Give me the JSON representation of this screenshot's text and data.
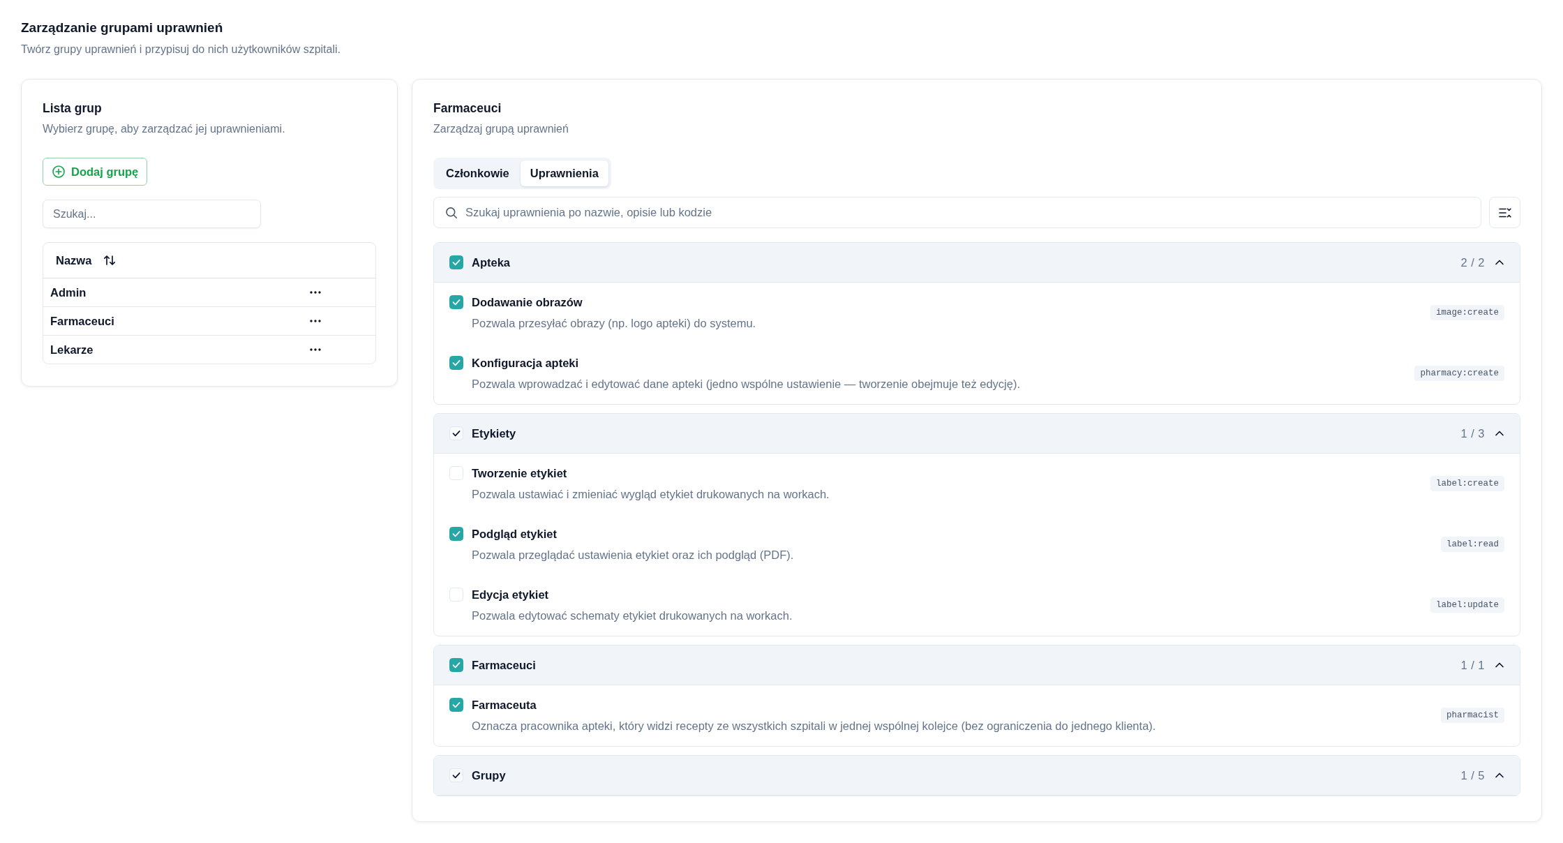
{
  "page": {
    "title": "Zarządzanie grupami uprawnień",
    "subtitle": "Twórz grupy uprawnień i przypisuj do nich użytkowników szpitali."
  },
  "group_list": {
    "title": "Lista grup",
    "subtitle": "Wybierz grupę, aby zarządzać jej uprawnieniami.",
    "add_button": "Dodaj grupę",
    "search": {
      "placeholder": "Szukaj..."
    },
    "table": {
      "columns": [
        "Nazwa"
      ],
      "rows": [
        {
          "name": "Admin"
        },
        {
          "name": "Farmaceuci"
        },
        {
          "name": "Lekarze"
        }
      ]
    }
  },
  "group_detail": {
    "title": "Farmaceuci",
    "subtitle": "Zarządzaj grupą uprawnień",
    "tabs": [
      {
        "label": "Członkowie",
        "selected": false
      },
      {
        "label": "Uprawnienia",
        "selected": true
      }
    ],
    "search": {
      "placeholder": "Szukaj uprawnienia po nazwie, opisie lub kodzie"
    },
    "permission_groups": [
      {
        "name": "Apteka",
        "checked": true,
        "indeterminate": false,
        "count": "2 / 2",
        "expanded": true,
        "permissions": [
          {
            "name": "Dodawanie obrazów",
            "description": "Pozwala przesyłać obrazy (np. logo apteki) do systemu.",
            "code": "image:create",
            "checked": true
          },
          {
            "name": "Konfiguracja apteki",
            "description": "Pozwala wprowadzać i edytować dane apteki (jedno wspólne ustawienie — tworzenie obejmuje też edycję).",
            "code": "pharmacy:create",
            "checked": true
          }
        ]
      },
      {
        "name": "Etykiety",
        "checked": false,
        "indeterminate": true,
        "count": "1 / 3",
        "expanded": true,
        "permissions": [
          {
            "name": "Tworzenie etykiet",
            "description": "Pozwala ustawiać i zmieniać wygląd etykiet drukowanych na workach.",
            "code": "label:create",
            "checked": false
          },
          {
            "name": "Podgląd etykiet",
            "description": "Pozwala przeglądać ustawienia etykiet oraz ich podgląd (PDF).",
            "code": "label:read",
            "checked": true
          },
          {
            "name": "Edycja etykiet",
            "description": "Pozwala edytować schematy etykiet drukowanych na workach.",
            "code": "label:update",
            "checked": false
          }
        ]
      },
      {
        "name": "Farmaceuci",
        "checked": true,
        "indeterminate": false,
        "count": "1 / 1",
        "expanded": true,
        "permissions": [
          {
            "name": "Farmaceuta",
            "description": "Oznacza pracownika apteki, który widzi recepty ze wszystkich szpitali w jednej wspólnej kolejce (bez ograniczenia do jednego klienta).",
            "code": "pharmacist",
            "checked": true
          }
        ]
      },
      {
        "name": "Grupy",
        "checked": false,
        "indeterminate": true,
        "count": "1 / 5",
        "expanded": true
      }
    ]
  }
}
